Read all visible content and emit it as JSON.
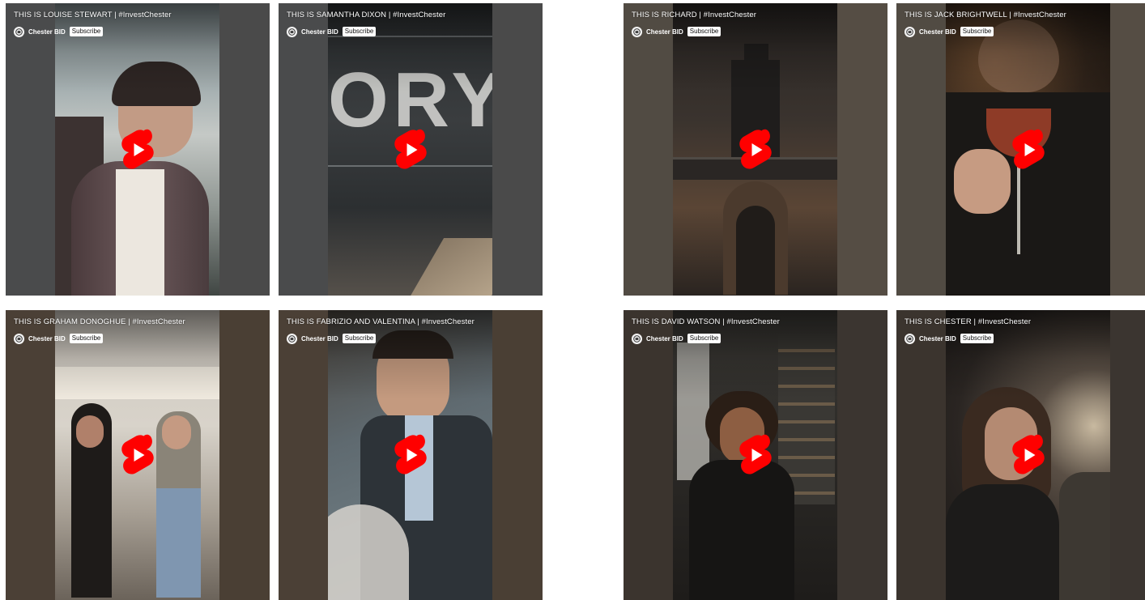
{
  "videos": [
    {
      "title": "THIS IS LOUISE STEWART | #InvestChester",
      "channel": "Chester BID",
      "subscribe": "Subscribe"
    },
    {
      "title": "THIS IS SAMANTHA DIXON | #InvestChester",
      "channel": "Chester BID",
      "subscribe": "Subscribe"
    },
    {
      "title": "THIS IS RICHARD | #InvestChester",
      "channel": "Chester BID",
      "subscribe": "Subscribe"
    },
    {
      "title": "THIS IS JACK BRIGHTWELL | #InvestChester",
      "channel": "Chester BID",
      "subscribe": "Subscribe"
    },
    {
      "title": "THIS IS GRAHAM DONOGHUE | #InvestChester",
      "channel": "Chester BID",
      "subscribe": "Subscribe"
    },
    {
      "title": "THIS IS FABRIZIO AND VALENTINA | #InvestChester",
      "channel": "Chester BID",
      "subscribe": "Subscribe"
    },
    {
      "title": "THIS IS DAVID WATSON | #InvestChester",
      "channel": "Chester BID",
      "subscribe": "Subscribe"
    },
    {
      "title": "THIS IS CHESTER | #InvestChester",
      "channel": "Chester BID",
      "subscribe": "Subscribe"
    }
  ],
  "icons": {
    "play": "youtube-shorts-play-icon",
    "avatar": "chester-bid-logo-icon"
  },
  "colors": {
    "shorts_red": "#ff0000",
    "title_text": "#ffffff",
    "subscribe_bg": "#ffffff"
  }
}
